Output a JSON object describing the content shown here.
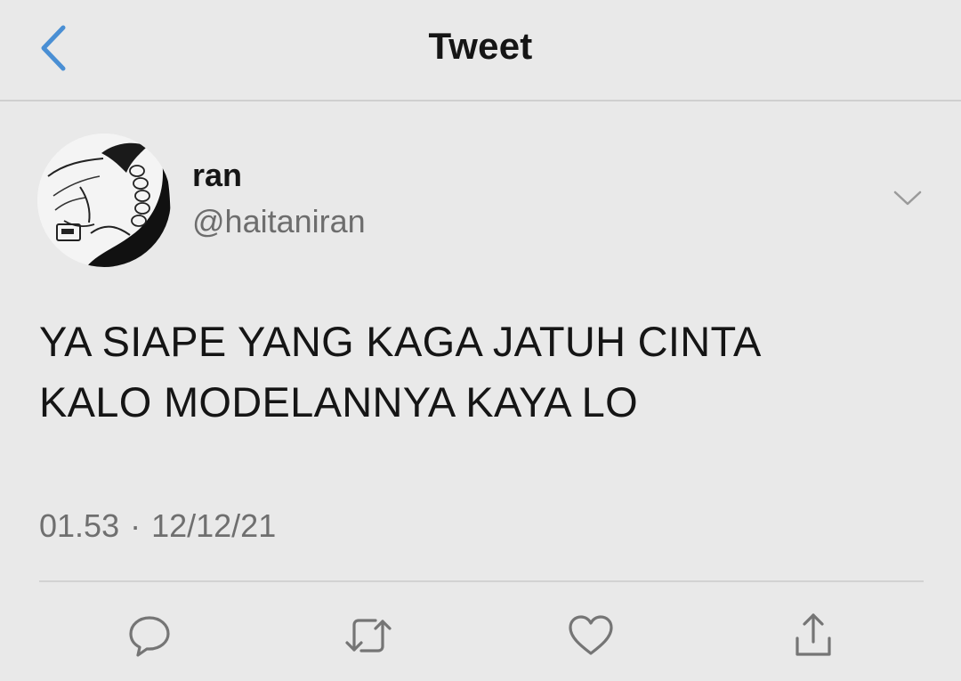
{
  "nav": {
    "title": "Tweet",
    "back_icon": "chevron-left-icon"
  },
  "tweet": {
    "author": {
      "display_name": "ran",
      "handle": "@haitaniran"
    },
    "text": "YA SIAPE YANG KAGA JATUH CINTA\nKALO MODELANNYA KAYA LO",
    "time": "01.53",
    "separator": "·",
    "date": "12/12/21"
  },
  "actions": [
    {
      "name": "reply",
      "icon": "comment-icon"
    },
    {
      "name": "retweet",
      "icon": "retweet-icon"
    },
    {
      "name": "like",
      "icon": "heart-icon"
    },
    {
      "name": "share",
      "icon": "share-icon"
    }
  ],
  "colors": {
    "background": "#e9e9e9",
    "accent": "#4a8fd4",
    "text": "#151515",
    "secondary_text": "#6d6d6d",
    "icon": "#757575"
  }
}
